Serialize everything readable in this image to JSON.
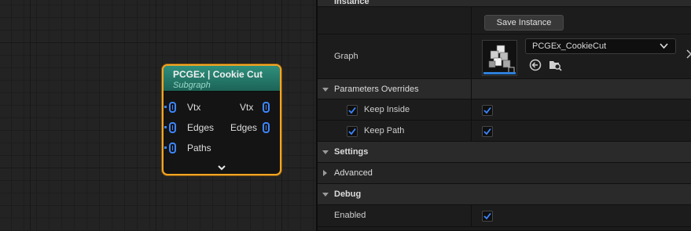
{
  "node": {
    "title": "PCGEx | Cookie Cut",
    "subtitle": "Subgraph",
    "inputs": [
      "Vtx",
      "Edges",
      "Paths"
    ],
    "outputs": [
      "Vtx",
      "Edges"
    ],
    "expand_icon": "chevron-down-icon",
    "pin_color": "#3d86ff",
    "header_color": "#2f8f7d",
    "selection_color": "#f5a623"
  },
  "details": {
    "instance_category": "Instance",
    "save_button": "Save Instance",
    "graph_label": "Graph",
    "graph_value": "PCGEx_CookieCut",
    "parameters_overrides": "Parameters Overrides",
    "overrides": [
      {
        "label": "Keep Inside",
        "enabled": true,
        "value": true
      },
      {
        "label": "Keep Path",
        "enabled": true,
        "value": true
      }
    ],
    "settings_category": "Settings",
    "advanced_category": "Advanced",
    "debug_category": "Debug",
    "enabled_label": "Enabled",
    "enabled_value": true,
    "check_color": "#3d86ff"
  }
}
